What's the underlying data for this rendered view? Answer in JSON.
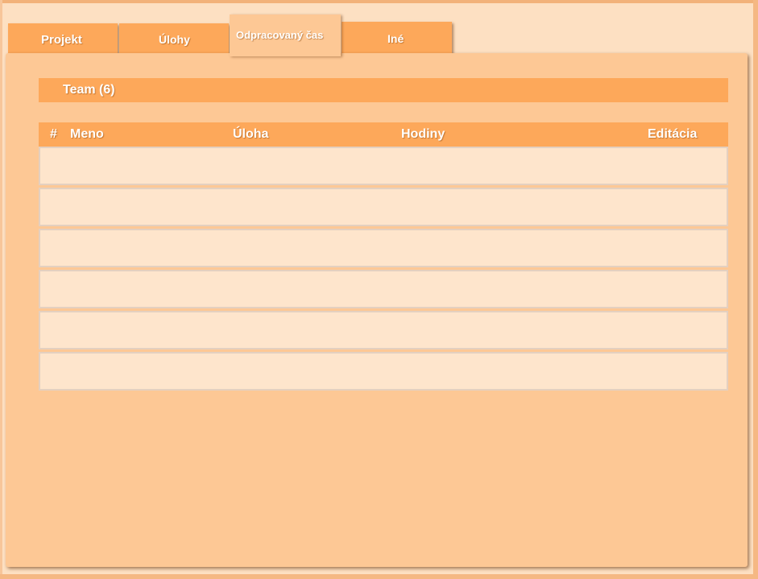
{
  "tabs": [
    {
      "label": "Projekt",
      "active": false
    },
    {
      "label": "Úlohy",
      "active": false
    },
    {
      "label": "Odpracovaný čas",
      "active": true
    },
    {
      "label": "Iné",
      "active": false
    }
  ],
  "team": {
    "title": "Team (6)"
  },
  "table": {
    "columns": [
      "#",
      "Meno",
      "Úloha",
      "Hodiny",
      "Editácia"
    ],
    "rows": [
      {
        "num": "",
        "meno": "",
        "uloha": "",
        "hodiny": "",
        "editacia": ""
      },
      {
        "num": "",
        "meno": "",
        "uloha": "",
        "hodiny": "",
        "editacia": ""
      },
      {
        "num": "",
        "meno": "",
        "uloha": "",
        "hodiny": "",
        "editacia": ""
      },
      {
        "num": "",
        "meno": "",
        "uloha": "",
        "hodiny": "",
        "editacia": ""
      },
      {
        "num": "",
        "meno": "",
        "uloha": "",
        "hodiny": "",
        "editacia": ""
      },
      {
        "num": "",
        "meno": "",
        "uloha": "",
        "hodiny": "",
        "editacia": ""
      }
    ]
  },
  "colors": {
    "background": "#fde0c2",
    "tab": "#fda85a",
    "panel": "#fdc895",
    "row": "#fee5cc"
  }
}
